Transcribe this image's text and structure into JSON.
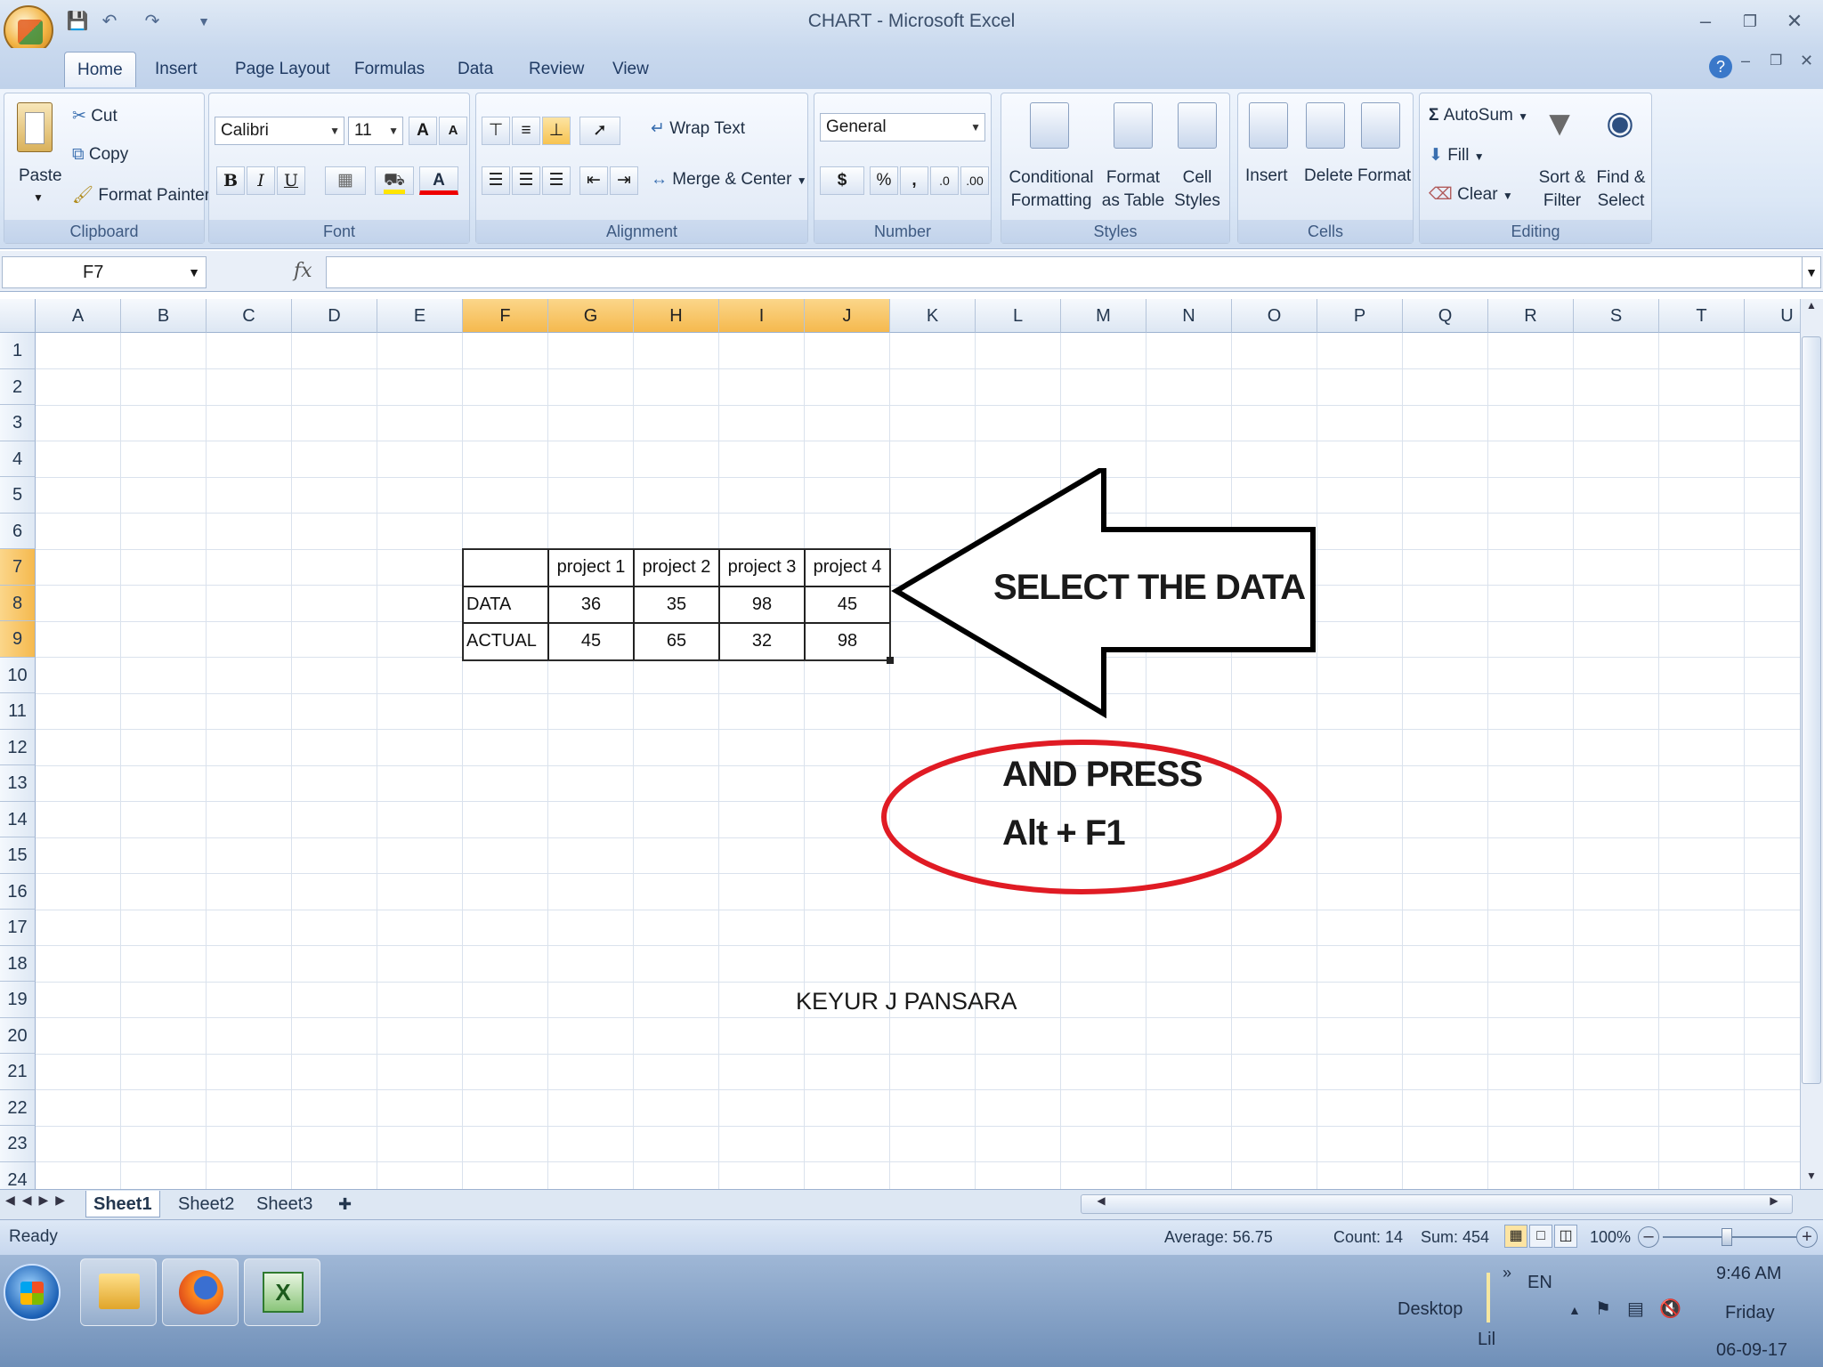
{
  "window": {
    "title": "CHART - Microsoft Excel"
  },
  "tabs": [
    "Home",
    "Insert",
    "Page Layout",
    "Formulas",
    "Data",
    "Review",
    "View"
  ],
  "clipboard": {
    "group": "Clipboard",
    "paste": "Paste",
    "cut": "Cut",
    "copy": "Copy",
    "format_painter": "Format Painter"
  },
  "font": {
    "group": "Font",
    "name": "Calibri",
    "size": "11",
    "bold": "B",
    "italic": "I",
    "underline": "U",
    "grow": "A",
    "shrink": "A",
    "color": "A"
  },
  "alignment": {
    "group": "Alignment",
    "wrap": "Wrap Text",
    "merge": "Merge & Center"
  },
  "number": {
    "group": "Number",
    "format": "General",
    "currency": "$",
    "percent": "%",
    "comma": ","
  },
  "styles": {
    "group": "Styles",
    "conditional": "Conditional",
    "conditional2": "Formatting",
    "format_table": "Format",
    "format_table2": "as Table",
    "cell_styles": "Cell",
    "cell_styles2": "Styles"
  },
  "cells": {
    "group": "Cells",
    "insert": "Insert",
    "delete": "Delete",
    "format": "Format"
  },
  "editing": {
    "group": "Editing",
    "autosum": "AutoSum",
    "fill": "Fill",
    "clear": "Clear",
    "sort": "Sort &",
    "sort2": "Filter",
    "find": "Find &",
    "find2": "Select"
  },
  "formula_bar": {
    "name_box": "F7",
    "fx": "fx",
    "value": ""
  },
  "columns": [
    "A",
    "B",
    "C",
    "D",
    "E",
    "F",
    "G",
    "H",
    "I",
    "J",
    "K",
    "L",
    "M",
    "N",
    "O",
    "P",
    "Q",
    "R",
    "S",
    "T",
    "U"
  ],
  "rows": [
    "1",
    "2",
    "3",
    "4",
    "5",
    "6",
    "7",
    "8",
    "9",
    "10",
    "11",
    "12",
    "13",
    "14",
    "15",
    "16",
    "17",
    "18",
    "19",
    "20",
    "21",
    "22",
    "23",
    "24"
  ],
  "table": {
    "headers": [
      "",
      "project 1",
      "project 2",
      "project 3",
      "project 4"
    ],
    "rows": [
      {
        "label": "DATA",
        "values": [
          "36",
          "35",
          "98",
          "45"
        ]
      },
      {
        "label": "ACTUAL",
        "values": [
          "45",
          "65",
          "32",
          "98"
        ]
      }
    ]
  },
  "annotations": {
    "arrow_text": "SELECT THE DATA",
    "oval_line1": "AND PRESS",
    "oval_line2": "Alt + F1",
    "author": "KEYUR J PANSARA"
  },
  "sheets": [
    "Sheet1",
    "Sheet2",
    "Sheet3"
  ],
  "status": {
    "ready": "Ready",
    "average": "Average: 56.75",
    "count": "Count: 14",
    "sum": "Sum: 454",
    "zoom": "100%"
  },
  "taskbar": {
    "desktop": "Desktop",
    "lang": "EN",
    "time": "9:46 AM",
    "day": "Friday",
    "date": "06-09-17",
    "lil": "Lil"
  },
  "colors": {
    "arrow": "#000000",
    "oval": "#e01b24",
    "selected_header": "#f5b94e"
  }
}
